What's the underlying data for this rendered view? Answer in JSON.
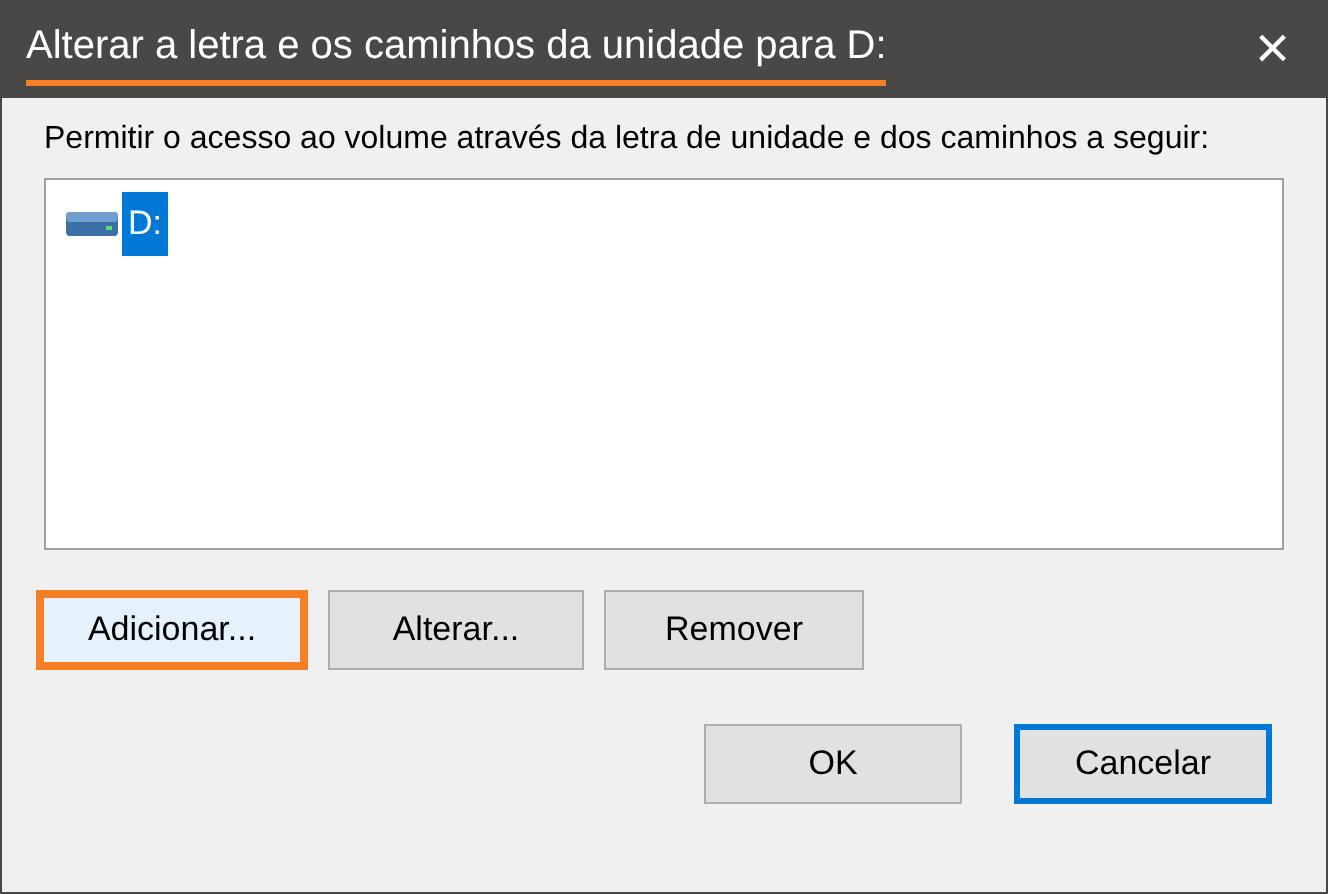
{
  "window": {
    "title": "Alterar a letra e os caminhos da unidade para D:",
    "title_highlighted": true,
    "close": "×"
  },
  "label": "Permitir o acesso ao volume através da letra de unidade e dos caminhos a seguir:",
  "list": {
    "items": [
      {
        "label": "D:",
        "selected": true
      }
    ]
  },
  "buttons": [
    {
      "label": "Adicionar...",
      "highlighted": true,
      "focused": false
    },
    {
      "label": "Alterar...",
      "highlighted": false,
      "focused": false
    },
    {
      "label": "Remover",
      "highlighted": false,
      "focused": false
    }
  ],
  "footer_buttons": [
    {
      "label": "OK",
      "highlighted": false,
      "focused": false
    },
    {
      "label": "Cancelar",
      "highlighted": false,
      "focused": true
    }
  ]
}
